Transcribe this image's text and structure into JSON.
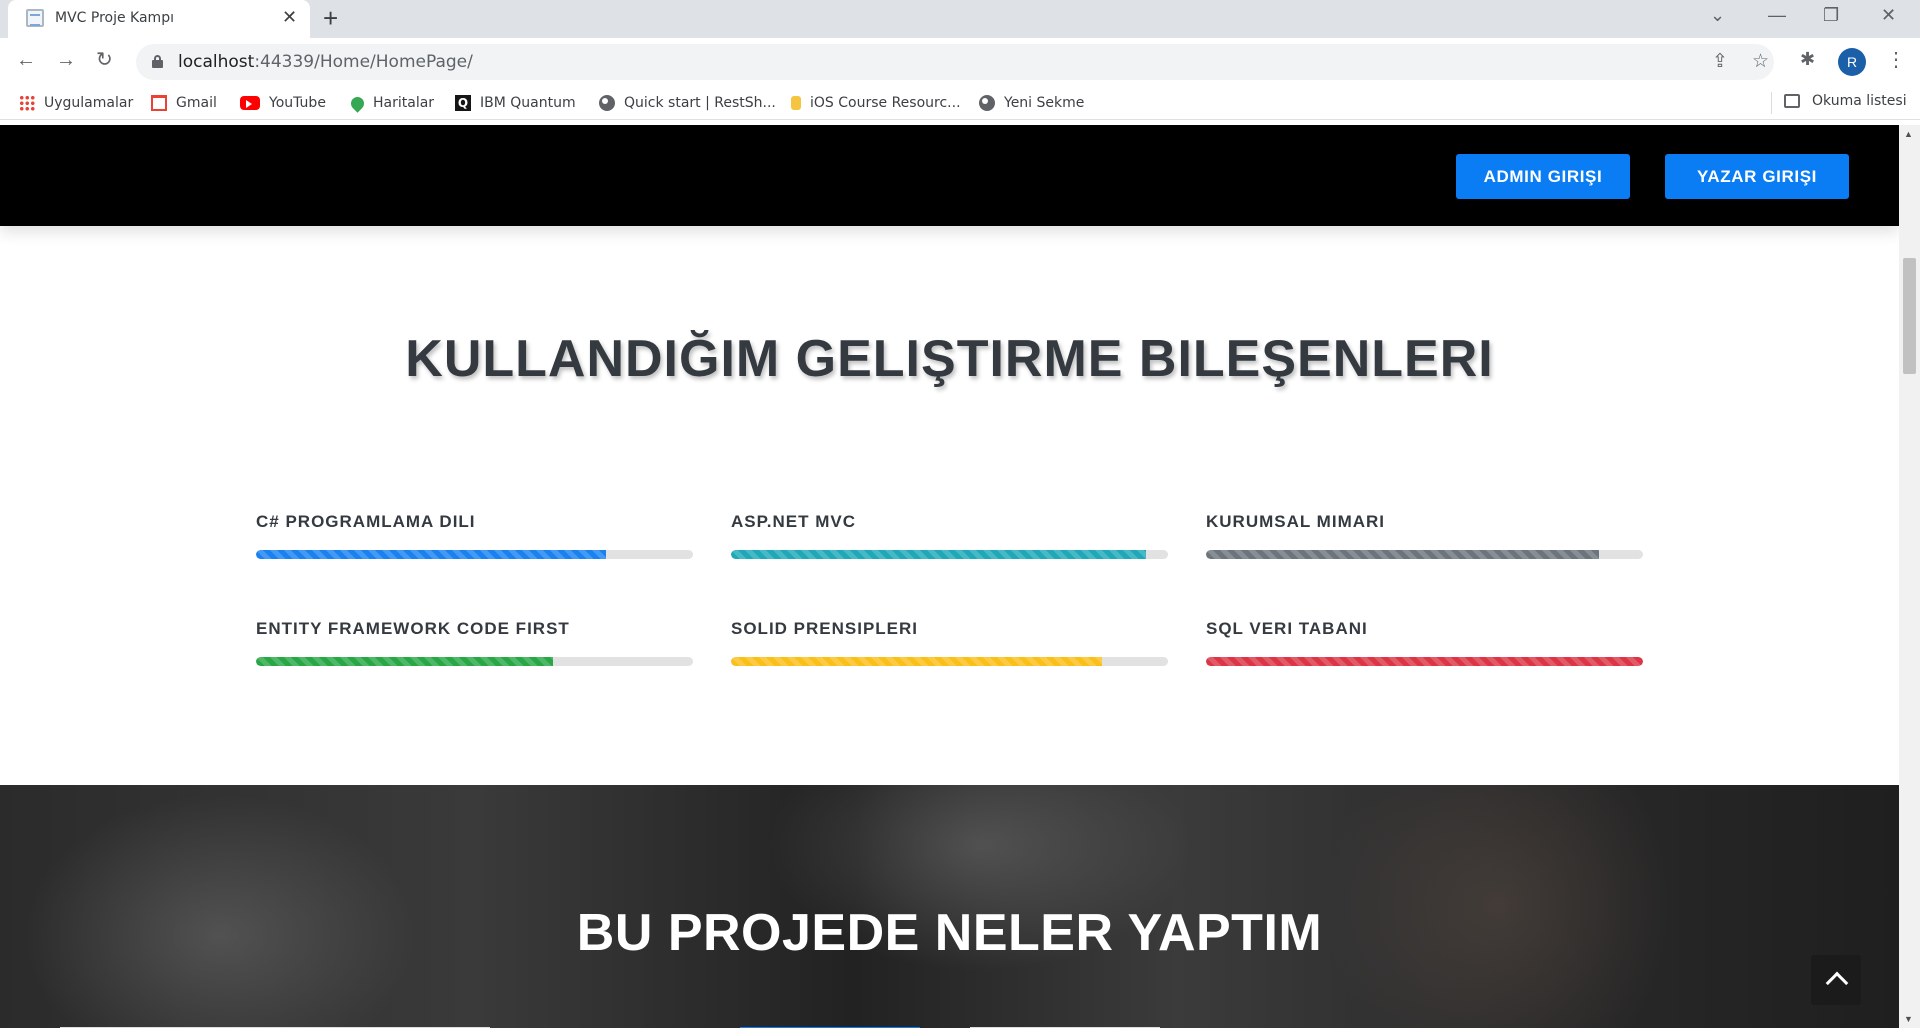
{
  "browser": {
    "tab_title": "MVC Proje Kampı",
    "url_host": "localhost",
    "url_path": ":44339/Home/HomePage/",
    "profile_initial": "R",
    "bookmarks": [
      {
        "label": "Uygulamalar",
        "icon": "apps-icon"
      },
      {
        "label": "Gmail",
        "icon": "gmail-icon"
      },
      {
        "label": "YouTube",
        "icon": "youtube-icon"
      },
      {
        "label": "Haritalar",
        "icon": "maps-icon"
      },
      {
        "label": "IBM Quantum",
        "icon": "ibm-quantum-icon"
      },
      {
        "label": "Quick start | RestSh...",
        "icon": "globe-icon"
      },
      {
        "label": "iOS Course Resourc...",
        "icon": "ios-course-icon"
      },
      {
        "label": "Yeni Sekme",
        "icon": "globe-icon"
      }
    ],
    "reading_list": "Okuma listesi"
  },
  "nav": {
    "admin_label": "ADMIN GIRIŞI",
    "writer_label": "YAZAR GIRIŞI",
    "button_color": "#0a7df5"
  },
  "skills": {
    "title": "KULLANDIĞIM GELIŞTIRME BILEŞENLERI",
    "items": [
      {
        "label": "C# PROGRAMLAMA DILI",
        "percent": 80,
        "color": "#1a82f0"
      },
      {
        "label": "ASP.NET MVC",
        "percent": 95,
        "color": "#1fa8b8"
      },
      {
        "label": "KURUMSAL MIMARI",
        "percent": 90,
        "color": "#6c757d"
      },
      {
        "label": "ENTITY FRAMEWORK CODE FIRST",
        "percent": 68,
        "color": "#28a745"
      },
      {
        "label": "SOLID PRENSIPLERI",
        "percent": 85,
        "color": "#fbbf1a"
      },
      {
        "label": "SQL VERI TABANI",
        "percent": 100,
        "color": "#dc3545"
      }
    ]
  },
  "projects": {
    "title": "BU PROJEDE NELER YAPTIM"
  }
}
